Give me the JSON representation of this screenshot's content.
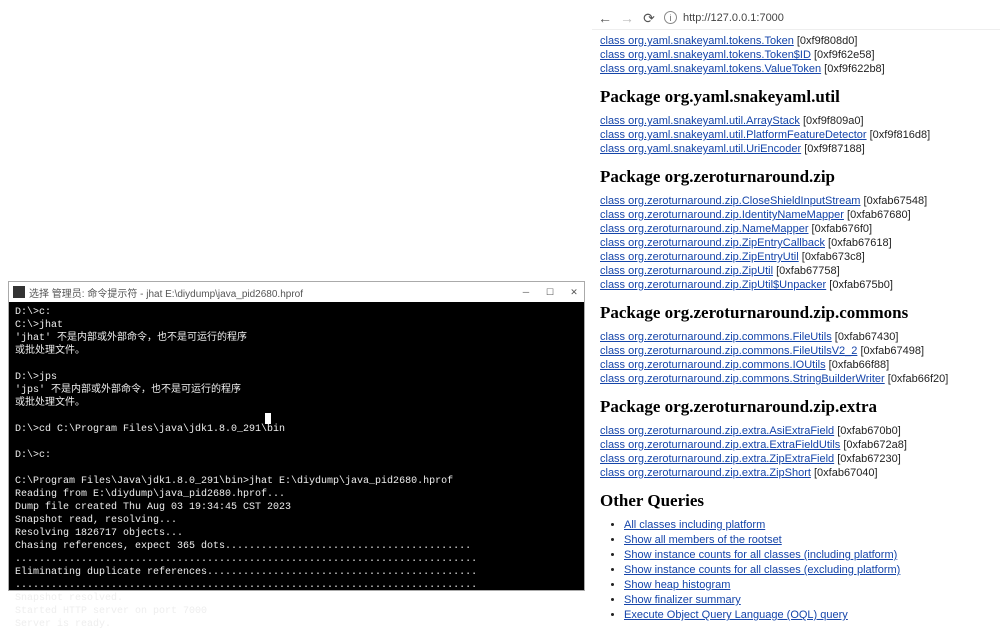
{
  "terminal": {
    "title": "选择 管理员: 命令提示符 - jhat  E:\\diydump\\java_pid2680.hprof",
    "lines": [
      "D:\\>c:",
      "C:\\>jhat",
      "'jhat' 不是内部或外部命令，也不是可运行的程序",
      "或批处理文件。",
      "",
      "D:\\>jps",
      "'jps' 不是内部或外部命令，也不是可运行的程序",
      "或批处理文件。",
      "",
      "D:\\>cd C:\\Program Files\\java\\jdk1.8.0_291\\bin",
      "",
      "D:\\>c:",
      "",
      "C:\\Program Files\\Java\\jdk1.8.0_291\\bin>jhat E:\\diydump\\java_pid2680.hprof",
      "Reading from E:\\diydump\\java_pid2680.hprof...",
      "Dump file created Thu Aug 03 19:34:45 CST 2023",
      "Snapshot read, resolving...",
      "Resolving 1826717 objects...",
      "Chasing references, expect 365 dots.........................................",
      ".............................................................................",
      "Eliminating duplicate references.............................................",
      ".............................................................................",
      "Snapshot resolved.",
      "Started HTTP server on port 7000",
      "Server is ready."
    ]
  },
  "browser": {
    "url": "http://127.0.0.1:7000",
    "topLinks": [
      {
        "text": "class org.yaml.snakeyaml.tokens.Token",
        "hex": "[0xf9f808d0]"
      },
      {
        "text": "class org.yaml.snakeyaml.tokens.Token$ID",
        "hex": "[0xf9f62e58]"
      },
      {
        "text": "class org.yaml.snakeyaml.tokens.ValueToken",
        "hex": "[0xf9f622b8]"
      }
    ],
    "sections": [
      {
        "heading": "Package org.yaml.snakeyaml.util",
        "links": [
          {
            "text": "class org.yaml.snakeyaml.util.ArrayStack",
            "hex": "[0xf9f809a0]"
          },
          {
            "text": "class org.yaml.snakeyaml.util.PlatformFeatureDetector",
            "hex": "[0xf9f816d8]"
          },
          {
            "text": "class org.yaml.snakeyaml.util.UriEncoder",
            "hex": "[0xf9f87188]"
          }
        ]
      },
      {
        "heading": "Package org.zeroturnaround.zip",
        "links": [
          {
            "text": "class org.zeroturnaround.zip.CloseShieldInputStream",
            "hex": "[0xfab67548]"
          },
          {
            "text": "class org.zeroturnaround.zip.IdentityNameMapper",
            "hex": "[0xfab67680]"
          },
          {
            "text": "class org.zeroturnaround.zip.NameMapper",
            "hex": "[0xfab676f0]"
          },
          {
            "text": "class org.zeroturnaround.zip.ZipEntryCallback",
            "hex": "[0xfab67618]"
          },
          {
            "text": "class org.zeroturnaround.zip.ZipEntryUtil",
            "hex": "[0xfab673c8]"
          },
          {
            "text": "class org.zeroturnaround.zip.ZipUtil",
            "hex": "[0xfab67758]"
          },
          {
            "text": "class org.zeroturnaround.zip.ZipUtil$Unpacker",
            "hex": "[0xfab675b0]"
          }
        ]
      },
      {
        "heading": "Package org.zeroturnaround.zip.commons",
        "links": [
          {
            "text": "class org.zeroturnaround.zip.commons.FileUtils",
            "hex": "[0xfab67430]"
          },
          {
            "text": "class org.zeroturnaround.zip.commons.FileUtilsV2_2",
            "hex": "[0xfab67498]"
          },
          {
            "text": "class org.zeroturnaround.zip.commons.IOUtils",
            "hex": "[0xfab66f88]"
          },
          {
            "text": "class org.zeroturnaround.zip.commons.StringBuilderWriter",
            "hex": "[0xfab66f20]"
          }
        ]
      },
      {
        "heading": "Package org.zeroturnaround.zip.extra",
        "links": [
          {
            "text": "class org.zeroturnaround.zip.extra.AsiExtraField",
            "hex": "[0xfab670b0]"
          },
          {
            "text": "class org.zeroturnaround.zip.extra.ExtraFieldUtils",
            "hex": "[0xfab672a8]"
          },
          {
            "text": "class org.zeroturnaround.zip.extra.ZipExtraField",
            "hex": "[0xfab67230]"
          },
          {
            "text": "class org.zeroturnaround.zip.extra.ZipShort",
            "hex": "[0xfab67040]"
          }
        ]
      }
    ],
    "otherQueriesHeading": "Other Queries",
    "otherQueries": [
      "All classes including platform",
      "Show all members of the rootset",
      "Show instance counts for all classes (including platform)",
      "Show instance counts for all classes (excluding platform)",
      "Show heap histogram",
      "Show finalizer summary",
      "Execute Object Query Language (OQL) query"
    ]
  }
}
